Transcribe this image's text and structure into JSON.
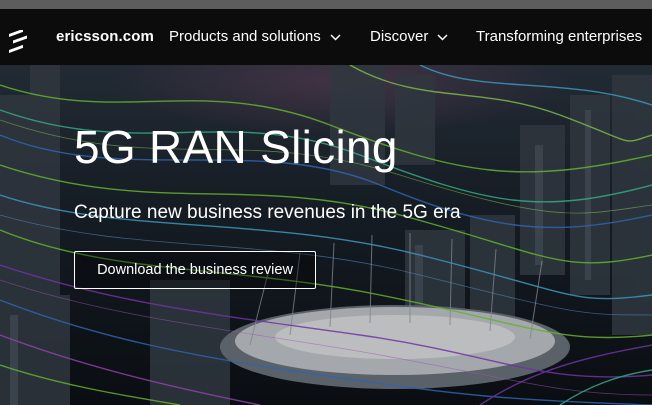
{
  "header": {
    "brand": "ericsson.com",
    "nav": [
      {
        "label": "Products and solutions",
        "has_dropdown": true
      },
      {
        "label": "Discover",
        "has_dropdown": true
      },
      {
        "label": "Transforming enterprises",
        "has_dropdown": false
      }
    ]
  },
  "hero": {
    "title": "5G RAN Slicing",
    "subtitle": "Capture new business revenues in the 5G era",
    "cta_label": "Download the business review"
  },
  "icons": {
    "logo": "ericsson-logo-icon",
    "dropdown": "chevron-down-icon"
  },
  "colors": {
    "nav_background": "#0c0c0c",
    "text": "#ffffff",
    "line_green": "#7bd83a",
    "line_blue": "#3a7bd5",
    "line_purple": "#8a3fc8"
  }
}
